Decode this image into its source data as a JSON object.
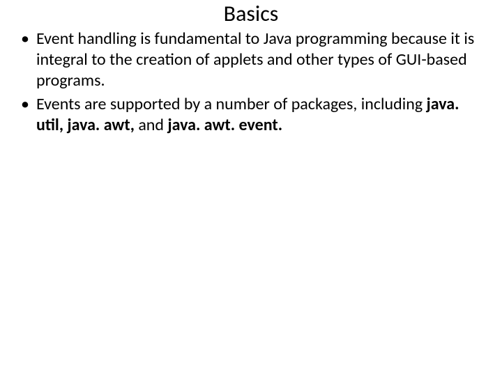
{
  "title": "Basics",
  "bullets": [
    {
      "pre": "Event handling is fundamental to Java programming because it is integral to the creation of applets and other types of GUI-based programs."
    },
    {
      "pre": "Events are supported by a number of packages, including ",
      "bold1": "java. util, java. awt, ",
      "mid": "and",
      "bold2": " java. awt. event."
    }
  ]
}
